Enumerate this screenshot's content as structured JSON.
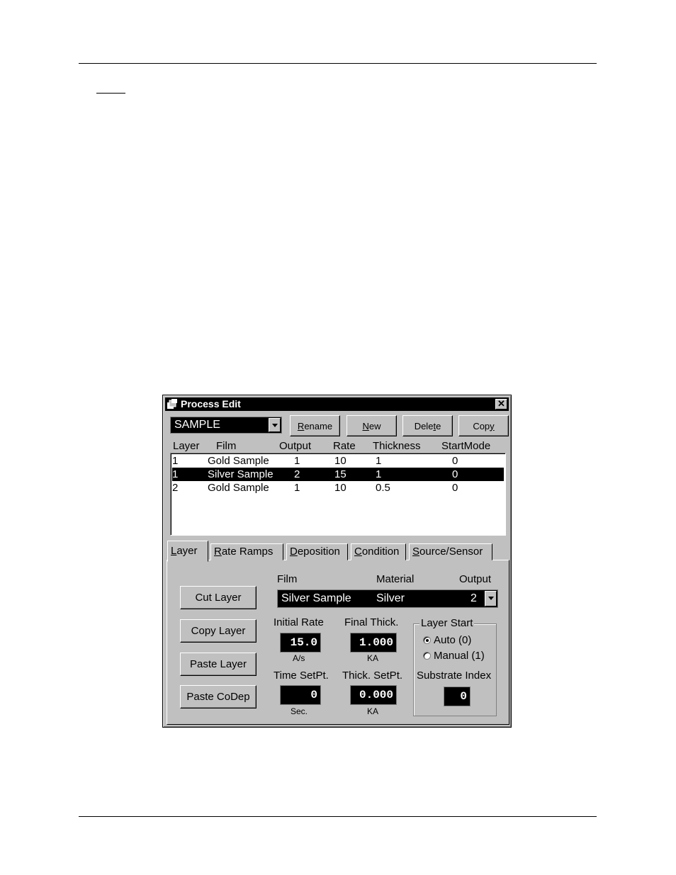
{
  "window": {
    "title": "Process Edit"
  },
  "process_combo": {
    "value": "SAMPLE"
  },
  "toolbar": {
    "rename": {
      "pre": "",
      "key": "R",
      "post": "ename"
    },
    "new": {
      "pre": "",
      "key": "N",
      "post": "ew"
    },
    "delete": {
      "pre": "Dele",
      "key": "t",
      "post": "e"
    },
    "copy": {
      "pre": "Cop",
      "key": "y",
      "post": ""
    }
  },
  "layer_list": {
    "columns": [
      "Layer",
      "Film",
      "Output",
      "Rate",
      "Thickness",
      "StartMode"
    ],
    "rows": [
      {
        "layer": "1",
        "film": "Gold Sample",
        "output": "1",
        "rate": "10",
        "thickness": "1",
        "startmode": "0",
        "selected": false
      },
      {
        "layer": "1",
        "film": "Silver Sample",
        "output": "2",
        "rate": "15",
        "thickness": "1",
        "startmode": "0",
        "selected": true
      },
      {
        "layer": "2",
        "film": "Gold Sample",
        "output": "1",
        "rate": "10",
        "thickness": "0.5",
        "startmode": "0",
        "selected": false
      }
    ]
  },
  "tabs": [
    {
      "key": "L",
      "rest": "ayer",
      "active": true
    },
    {
      "key": "R",
      "rest": "ate Ramps",
      "active": false
    },
    {
      "key": "D",
      "rest": "eposition",
      "active": false
    },
    {
      "key": "C",
      "rest": "ondition",
      "active": false
    },
    {
      "key": "S",
      "rest": "ource/Sensor",
      "active": false
    }
  ],
  "layer_tab": {
    "buttons": {
      "cut": "Cut Layer",
      "copy": "Copy Layer",
      "paste": "Paste Layer",
      "paste_codep": "Paste CoDep"
    },
    "film_header": "Film",
    "material_header": "Material",
    "output_header": "Output",
    "film_value": "Silver Sample",
    "material_value": "Silver",
    "output_value": "2",
    "initial_rate_label": "Initial  Rate",
    "initial_rate_value": "15.0",
    "initial_rate_unit": "A/s",
    "final_thick_label": "Final Thick.",
    "final_thick_value": "1.000",
    "final_thick_unit": "KA",
    "time_setpt_label": "Time SetPt.",
    "time_setpt_value": "0",
    "time_setpt_unit": "Sec.",
    "thick_setpt_label": "Thick. SetPt.",
    "thick_setpt_value": "0.000",
    "thick_setpt_unit": "KA",
    "layer_start_title": "Layer Start",
    "radio_auto": "Auto (0)",
    "radio_manual": "Manual (1)",
    "radio_selected": "auto",
    "substrate_label": "Substrate Index",
    "substrate_value": "0"
  }
}
